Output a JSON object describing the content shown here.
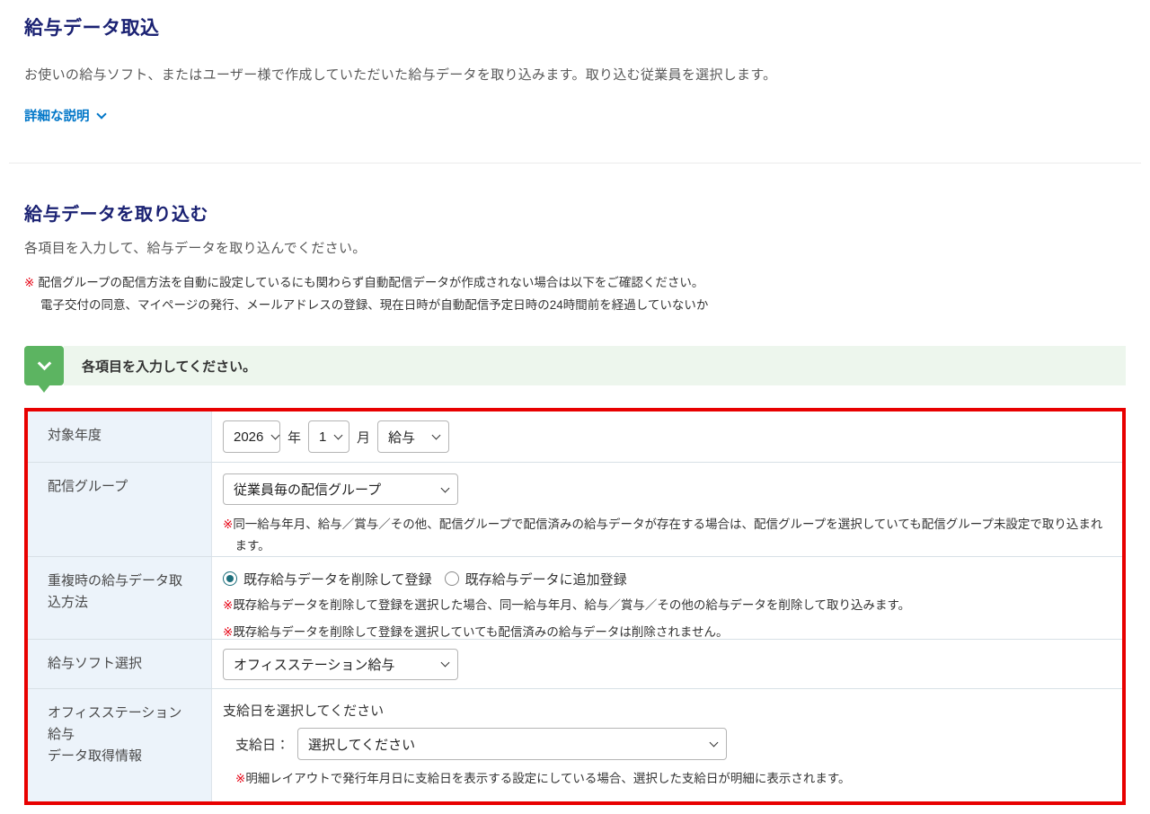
{
  "symbols": {
    "note_mark": "※"
  },
  "colors": {
    "heading_navy": "#1b2273",
    "link_blue": "#0076c8",
    "note_red": "#e60012",
    "table_border_red": "#e80000",
    "label_cell_bg": "#ecf3fa",
    "banner_bg": "#edf6ed",
    "banner_icon_green": "#5cb461",
    "radio_checked_teal": "#1d6f7c"
  },
  "header": {
    "title": "給与データ取込",
    "description": "お使いの給与ソフト、またはユーザー様で作成していただいた給与データを取り込みます。取り込む従業員を選択します。",
    "detail_link_label": "詳細な説明"
  },
  "section": {
    "title": "給与データを取り込む",
    "lead": "各項目を入力して、給与データを取り込んでください。",
    "note_line1": "配信グループの配信方法を自動に設定しているにも関わらず自動配信データが作成されない場合は以下をご確認ください。",
    "note_line2": "電子交付の同意、マイページの発行、メールアドレスの登録、現在日時が自動配信予定日時の24時間前を経過していないか"
  },
  "banner": {
    "text": "各項目を入力してください。"
  },
  "form": {
    "target_year": {
      "label": "対象年度",
      "year_value": "2026",
      "year_unit": "年",
      "month_value": "1",
      "month_unit": "月",
      "paytype_value": "給与"
    },
    "delivery_group": {
      "label": "配信グループ",
      "select_value": "従業員毎の配信グループ",
      "note": "同一給与年月、給与／賞与／その他、配信グループで配信済みの給与データが存在する場合は、配信グループを選択していても配信グループ未設定で取り込まれます。"
    },
    "duplicate_method": {
      "label": "重複時の給与データ取込方法",
      "radio_delete_label": "既存給与データを削除して登録",
      "radio_append_label": "既存給与データに追加登録",
      "note1": "既存給与データを削除して登録を選択した場合、同一給与年月、給与／賞与／その他の給与データを削除して取り込みます。",
      "note2": "既存給与データを削除して登録を選択していても配信済みの給与データは削除されません。"
    },
    "software_select": {
      "label": "給与ソフト選択",
      "select_value": "オフィスステーション給与"
    },
    "data_info": {
      "label_line1": "オフィスステーション給与",
      "label_line2": "データ取得情報",
      "heading": "支給日を選択してください",
      "payday_label": "支給日：",
      "payday_value": "選択してください",
      "note": "明細レイアウトで発行年月日に支給日を表示する設定にしている場合、選択した支給日が明細に表示されます。"
    }
  }
}
